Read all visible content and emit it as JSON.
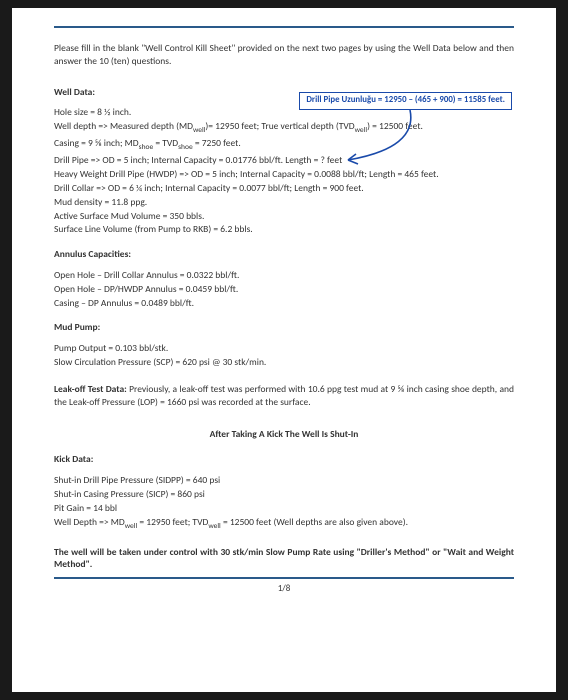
{
  "intro": "Please fill in the blank \"Well Control Kill Sheet\" provided on the next two pages by using the Well Data below and then answer the 10 (ten) questions.",
  "callout": "Drill Pipe Uzunluğu = 12950 – (465 + 900) = 11585 feet.",
  "wellData": {
    "heading": "Well Data:",
    "holeSize": "Hole size       =  8 ½ inch.",
    "wellDepth_a": "Well depth   => Measured depth (MD",
    "wellDepth_b": ")= 12950 feet;  True vertical depth (TVD",
    "wellDepth_c": ") = 12500 feet.",
    "casing_a": "Casing          =  9 ⅝ inch;       MD",
    "casing_b": " = TVD",
    "casing_c": " = 7250 feet.",
    "drillPipe": "Drill Pipe      =>  OD = 5 inch;   Internal Capacity = 0.01776 bbl/ft.     Length  =   ?   feet",
    "hwdp": "Heavy Weight Drill Pipe (HWDP) =>  OD = 5 inch; Internal Capacity = 0.0088 bbl/ft;    Length = 465 feet.",
    "drillCollar": "Drill Collar      =>  OD = 6 ¼ inch;  Internal Capacity = 0.0077 bbl/ft;   Length = 900 feet.",
    "mudDensity": "Mud density   =   11.8 ppg.",
    "activeSurface": "Active Surface Mud Volume                          = 350 bbls.",
    "surfaceLine": "Surface Line Volume (from Pump to RKB)    =  6.2 bbls."
  },
  "annulus": {
    "heading": "Annulus Capacities:",
    "l1": "Open Hole – Drill Collar  Annulus  =  0.0322 bbl/ft.",
    "l2": "Open Hole – DP/HWDP  Annulus  =  0.0459 bbl/ft.",
    "l3": "Casing – DP   Annulus                     =  0.0489 bbl/ft."
  },
  "pump": {
    "heading": "Mud Pump:",
    "l1": "Pump Output                                       =  0.103 bbl/stk.",
    "l2": "Slow Circulation Pressure (SCP)    =  620 psi @ 30 stk/min."
  },
  "leakoff_a": "Leak-off Test Data:",
  "leakoff_b": "  Previously, a leak-off test was performed with 10.6 ppg test mud at 9 ⅝ inch casing shoe depth, and the Leak-off Pressure (LOP) = 1660 psi was recorded at the surface.",
  "afterKick": "After Taking A Kick The Well Is Shut-In",
  "kick": {
    "heading": "Kick Data:",
    "l1": "Shut-in Drill Pipe Pressure (SIDPP)  =  640 psi",
    "l2": "Shut-in Casing Pressure (SICP)          =  860 psi",
    "l3": "Pit Gain                                                 =   14 bbl",
    "l4a": "Well Depth  =>  MD",
    "l4b": " = 12950 feet; TVD",
    "l4c": " = 12500 feet  (Well depths are also given above)."
  },
  "method": "The well will be taken under control with 30 stk/min Slow Pump Rate using \"Driller's Method\" or \"Wait and Weight Method\".",
  "pageNum": "1/8",
  "sub": {
    "well": "well",
    "shoe": "shoe"
  }
}
